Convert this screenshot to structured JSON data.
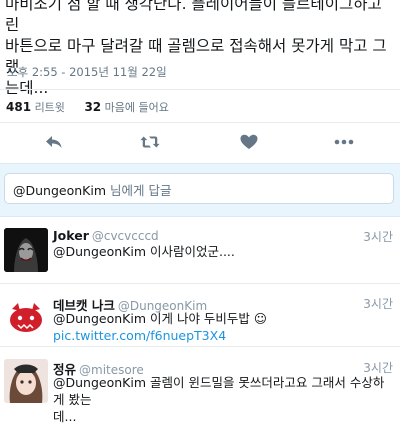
{
  "tweet": {
    "text_line1": "마비조기 점 할 때 생각난다. 플레이어들이 블르테이그하고 린",
    "text_line2": "바튼으로 마구 달려갈 때 골렘으로 접속해서 못가게 막고 그랬",
    "text_line3": "는데...",
    "timestamp": "오후 2:55 - 2015년 11월 22일",
    "retweets_count": "481",
    "retweets_label": "리트윗",
    "likes_count": "32",
    "likes_label": "마음에 들어요"
  },
  "actions": {
    "reply_icon": "reply-icon",
    "retweet_icon": "retweet-icon",
    "like_icon": "heart-icon",
    "more_icon": "more-icon"
  },
  "reply_input": {
    "mention": "@DungeonKim",
    "placeholder_suffix": " 님에게 답글"
  },
  "replies": [
    {
      "name": "Joker",
      "handle": "@cvcvcccd",
      "time": "3시간",
      "text": "@DungeonKim 이사람이었군...."
    },
    {
      "name": "데브캣 나크",
      "handle": "@DungeonKim",
      "time": "3시간",
      "text": "@DungeonKim 이게 나야 두비두밥 ☺ ",
      "link": "pic.twitter.com/f6nuepT3X4"
    },
    {
      "name": "정유",
      "handle": "@mitesore",
      "time": "3시간",
      "text_line1": "@DungeonKim 골렘이 윈드밀을 못쓰더라고요 그래서 수상하게 봤는",
      "text_line2": "데..."
    }
  ],
  "colors": {
    "accent": "#1b95e0",
    "muted": "#657786",
    "reply_bg": "#e8f5fd"
  }
}
